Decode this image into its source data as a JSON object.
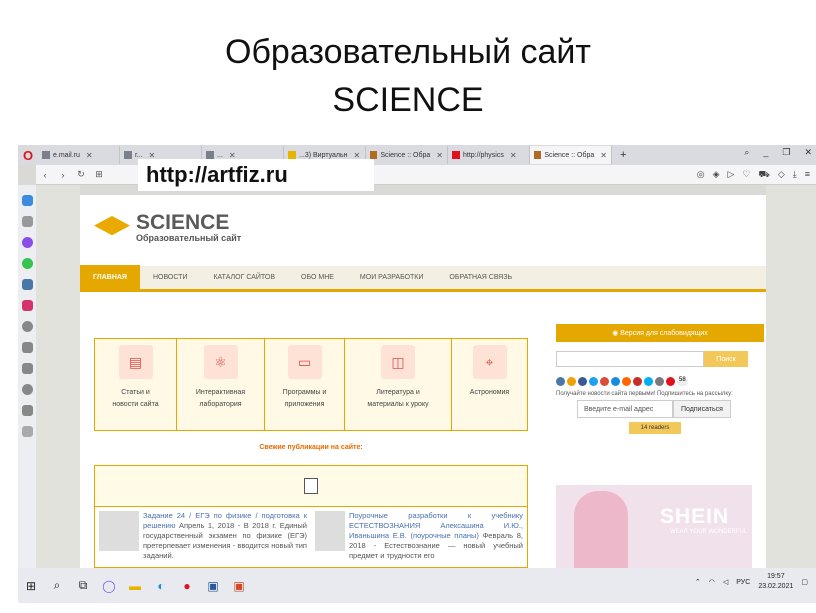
{
  "slide": {
    "title_line1": "Образовательный сайт",
    "title_line2": "SCIENCE"
  },
  "browser": {
    "tabs": [
      {
        "label": "e.mail.ru"
      },
      {
        "label": "г..."
      },
      {
        "label": "..."
      },
      {
        "label": "...3) Виртуальн"
      },
      {
        "label": "Science :: Обра"
      },
      {
        "label": "http://physics"
      },
      {
        "label": "Science :: Обра"
      }
    ],
    "url_overlay": "http://artfiz.ru"
  },
  "site": {
    "logo_title": "SCIENCE",
    "logo_subtitle": "Образовательный сайт",
    "menu": [
      "ГЛАВНАЯ",
      "НОВОСТИ",
      "КАТАЛОГ САЙТОВ",
      "ОБО МНЕ",
      "МОИ РАЗРАБОТКИ",
      "ОБРАТНАЯ СВЯЗЬ"
    ],
    "categories": [
      {
        "line1": "Статьи и",
        "line2": "новости сайта",
        "icon": "book-icon"
      },
      {
        "line1": "Интерактивная",
        "line2": "лаборатория",
        "icon": "atom-icon"
      },
      {
        "line1": "Программы и",
        "line2": "приложения",
        "icon": "monitor-icon"
      },
      {
        "line1": "Литература и",
        "line2": "материалы к уроку",
        "icon": "open-book-icon"
      },
      {
        "line1": "Астрономия",
        "line2": "",
        "icon": "telescope-icon"
      }
    ],
    "fresh_title": "Свежие публикации на сайте:",
    "news": [
      {
        "link": "Задание 24 / ЕГЭ по физике / подготовка к решению",
        "text": " Апрель 1, 2018 - В 2018 г. Единый государственный экзамен по физике (ЕГЭ) претерпевает изменения - вводится новый тип заданий."
      },
      {
        "link": "Поурочные разработки к учебнику ЕСТЕСТВОЗНАНИЯ Алексашина И.Ю., Иваньшина Е.В. (поурочные планы)",
        "text": " Февраль 8, 2018 - Естествознание — новый учебный предмет и трудности его"
      }
    ],
    "access_label": "Версия для слабовидящих",
    "search_button": "Поиск",
    "subscribe_note": "Получайте новости сайта первыми! Подпишитесь на рассылку:",
    "email_placeholder": "Введите e-mail адрес",
    "subscribe_button": "Подписаться",
    "readers": "14 readers",
    "social_count": "58",
    "ad_brand": "SHEIN",
    "ad_tag": "WEAR YOUR WONDERFUL"
  },
  "taskbar": {
    "lang": "РУС",
    "time": "19:57",
    "date": "23.02.2021"
  }
}
